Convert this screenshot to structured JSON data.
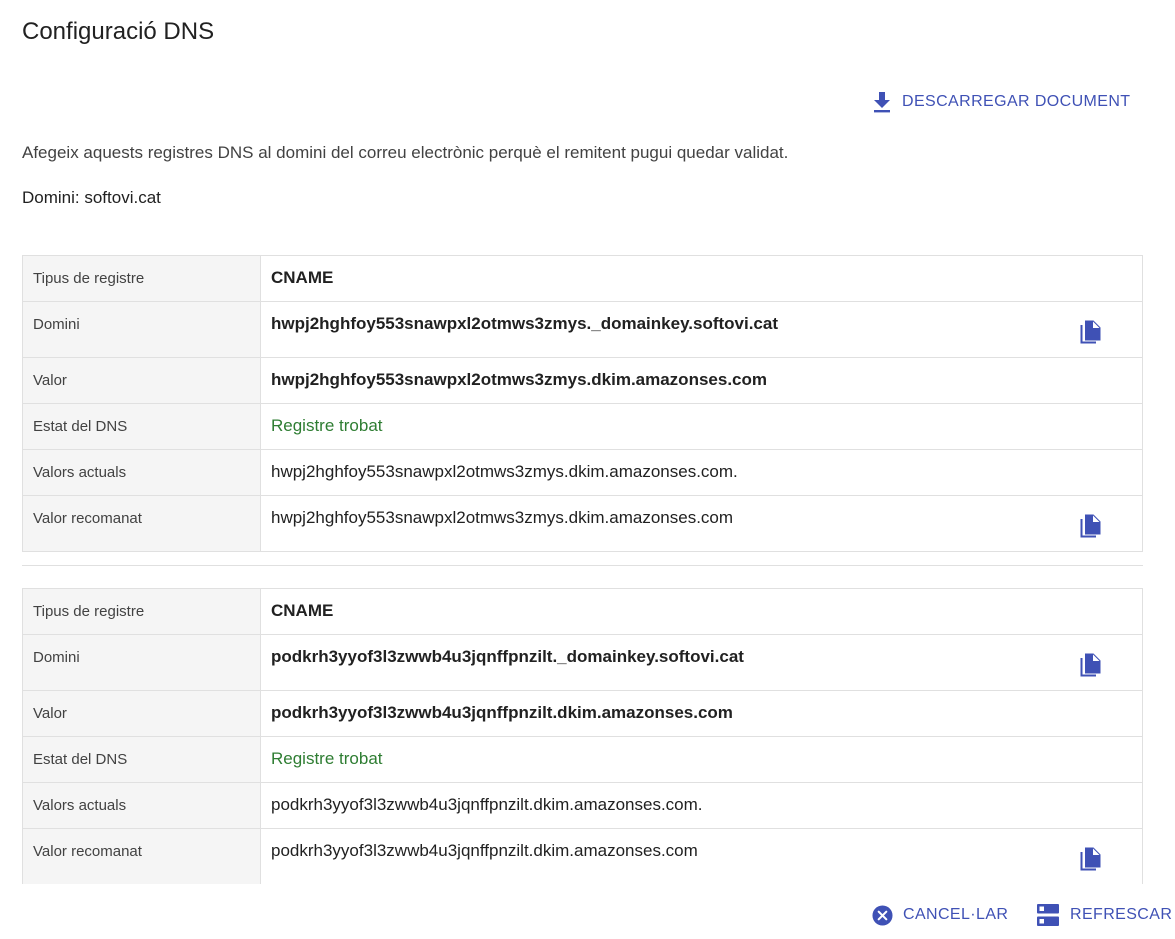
{
  "header": {
    "title": "Configuració DNS"
  },
  "toolbar": {
    "download_label": "DESCARREGAR DOCUMENT",
    "download_icon": "download-icon"
  },
  "intro": {
    "description": "Afegeix aquests registres DNS al domini del correu electrònic perquè el remitent pugui quedar validat.",
    "domain_line": "Domini: softovi.cat"
  },
  "labels": {
    "record_type": "Tipus de registre",
    "domain": "Domini",
    "value": "Valor",
    "dns_status": "Estat del DNS",
    "current_values": "Valors actuals",
    "recommended_value": "Valor recomanat"
  },
  "records": [
    {
      "type": "CNAME",
      "domain": "hwpj2hghfoy553snawpxl2otmws3zmys._domainkey.softovi.cat",
      "value": "hwpj2hghfoy553snawpxl2otmws3zmys.dkim.amazonses.com",
      "status": "Registre trobat",
      "current_values": "hwpj2hghfoy553snawpxl2otmws3zmys.dkim.amazonses.com.",
      "recommended_value": "hwpj2hghfoy553snawpxl2otmws3zmys.dkim.amazonses.com"
    },
    {
      "type": "CNAME",
      "domain": "podkrh3yyof3l3zwwb4u3jqnffpnzilt._domainkey.softovi.cat",
      "value": "podkrh3yyof3l3zwwb4u3jqnffpnzilt.dkim.amazonses.com",
      "status": "Registre trobat",
      "current_values": "podkrh3yyof3l3zwwb4u3jqnffpnzilt.dkim.amazonses.com.",
      "recommended_value": "podkrh3yyof3l3zwwb4u3jqnffpnzilt.dkim.amazonses.com"
    }
  ],
  "footer": {
    "cancel_label": "CANCEL·LAR",
    "refresh_label": "REFRESCAR"
  },
  "colors": {
    "accent": "#3f51b5",
    "status_ok": "#2e7d32",
    "label_bg": "#f5f5f5",
    "border": "#e0e0e0"
  }
}
